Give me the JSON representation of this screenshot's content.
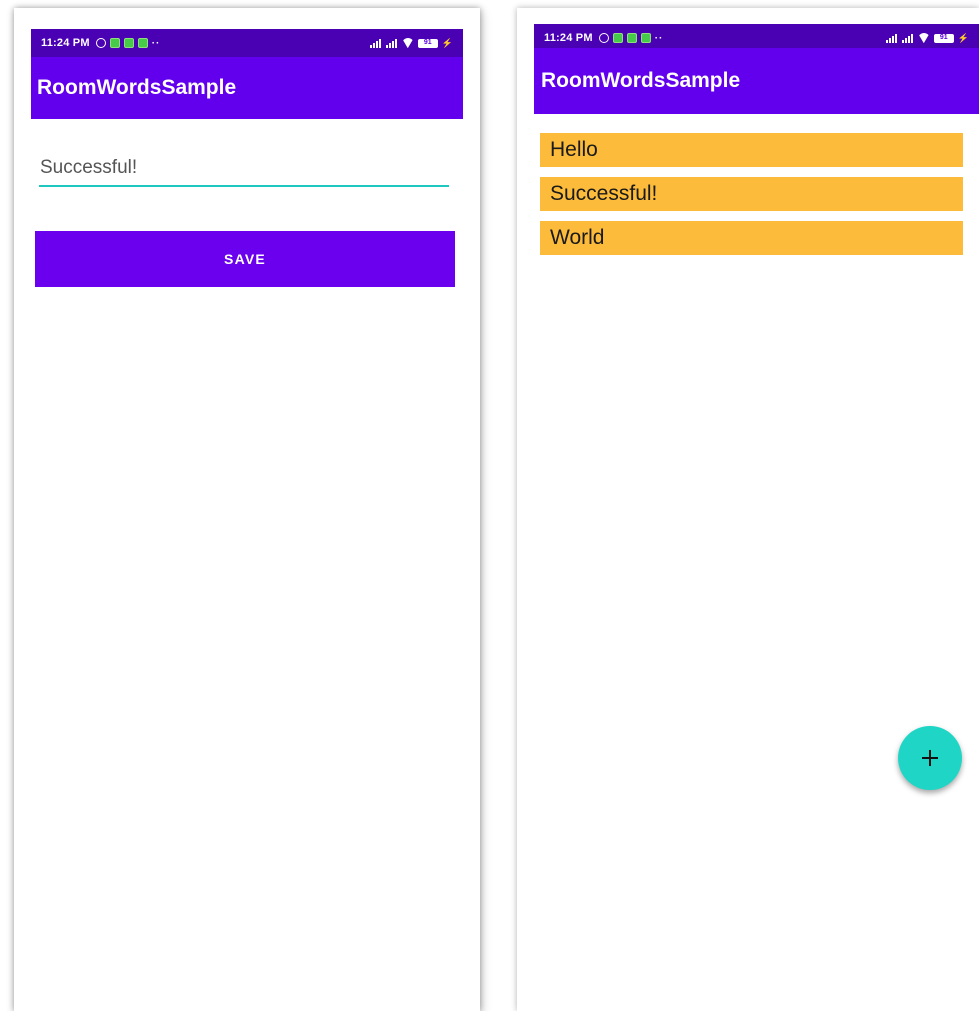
{
  "left_screen": {
    "status_bar": {
      "time": "11:24 PM",
      "battery": "91"
    },
    "app_bar": {
      "title": "RoomWordsSample"
    },
    "new_word_field": {
      "value": "Successful!"
    },
    "save_button": {
      "label": "SAVE"
    }
  },
  "right_screen": {
    "status_bar": {
      "time": "11:24 PM",
      "battery": "91"
    },
    "app_bar": {
      "title": "RoomWordsSample"
    },
    "words": [
      "Hello",
      "Successful!",
      "World"
    ],
    "fab": {
      "icon": "plus-icon"
    }
  },
  "colors": {
    "primary": "#6200ee",
    "primary_dark": "#4a00b3",
    "accent": "#1fd6c6",
    "list_item": "#fcbb3a"
  }
}
